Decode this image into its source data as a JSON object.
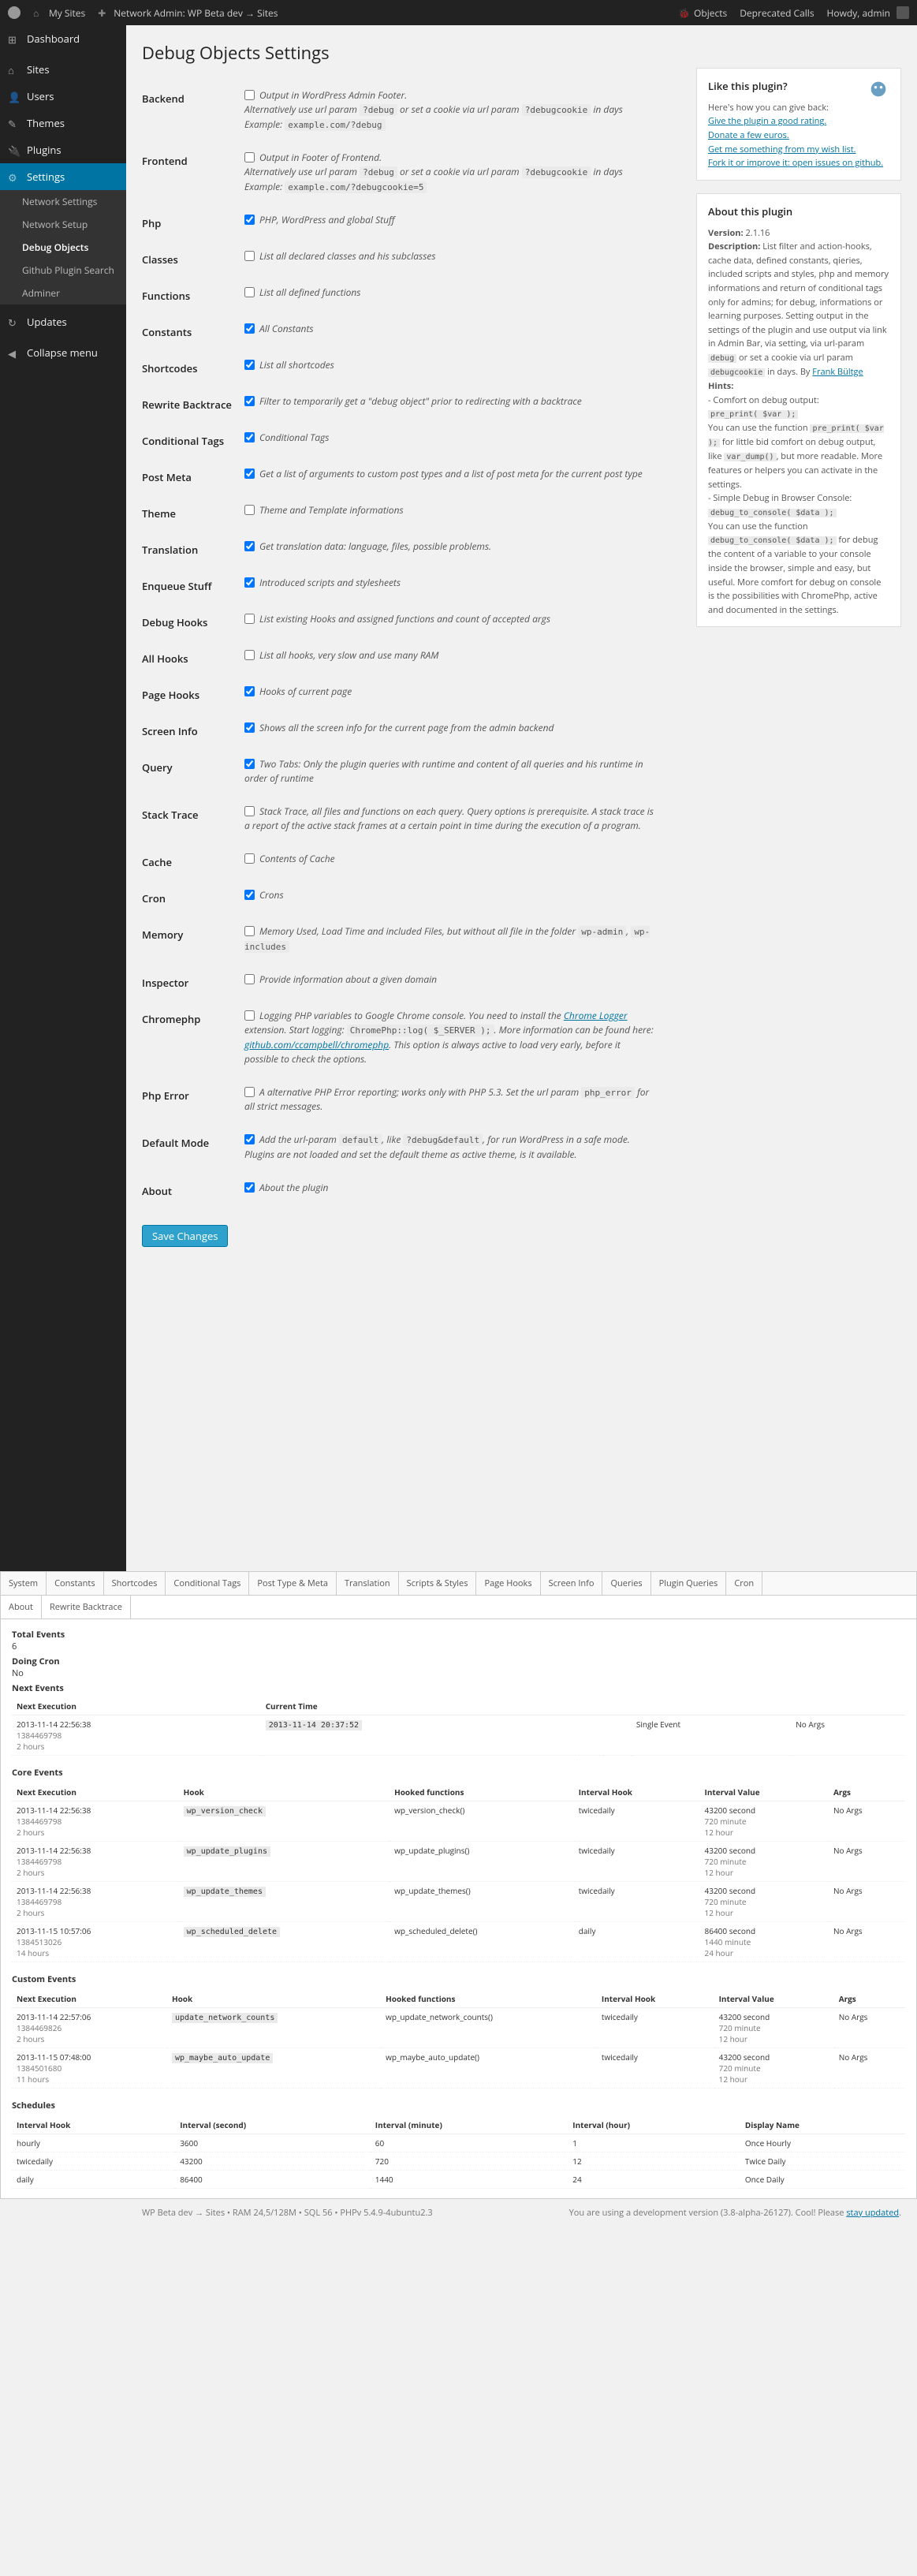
{
  "adminbar": {
    "mysites": "My Sites",
    "network": "Network Admin: WP Beta dev → Sites",
    "objects": "Objects",
    "deprecated": "Deprecated Calls",
    "howdy": "Howdy, admin"
  },
  "menu": {
    "dashboard": "Dashboard",
    "sites": "Sites",
    "users": "Users",
    "themes": "Themes",
    "plugins": "Plugins",
    "settings": "Settings",
    "sub_network_settings": "Network Settings",
    "sub_network_setup": "Network Setup",
    "sub_debug_objects": "Debug Objects",
    "sub_github_plugin_search": "Github Plugin Search",
    "sub_adminer": "Adminer",
    "updates": "Updates",
    "collapse": "Collapse menu"
  },
  "page": {
    "title": "Debug Objects Settings"
  },
  "rows": {
    "backend": {
      "label": "Backend",
      "text1": "Output in WordPress Admin Footer.",
      "text2": "Alternatively use url param ",
      "code1": "?debug",
      "text3": " or set a cookie via url param ",
      "code2": "?debugcookie",
      "text4": " in days",
      "text5": "Example: ",
      "code3": "example.com/?debug"
    },
    "frontend": {
      "label": "Frontend",
      "text1": "Output in Footer of Frontend.",
      "text2": "Alternatively use url param ",
      "code1": "?debug",
      "text3": " or set a cookie via url param ",
      "code2": "?debugcookie",
      "text4": " in days",
      "text5": "Example: ",
      "code3": "example.com/?debugcookie=5"
    },
    "php": {
      "label": "Php",
      "text": "PHP, WordPress and global Stuff"
    },
    "classes": {
      "label": "Classes",
      "text": "List all declared classes and his subclasses"
    },
    "functions": {
      "label": "Functions",
      "text": "List all defined functions"
    },
    "constants": {
      "label": "Constants",
      "text": "All Constants"
    },
    "shortcodes": {
      "label": "Shortcodes",
      "text": "List all shortcodes"
    },
    "rewrite": {
      "label": "Rewrite Backtrace",
      "text": "Filter to temporarily get a \"debug object\" prior to redirecting with a backtrace"
    },
    "condtags": {
      "label": "Conditional Tags",
      "text": "Conditional Tags"
    },
    "postmeta": {
      "label": "Post Meta",
      "text": "Get a list of arguments to custom post types and a list of post meta for the current post type"
    },
    "theme": {
      "label": "Theme",
      "text": "Theme and Template informations"
    },
    "translation": {
      "label": "Translation",
      "text": "Get translation data: language, files, possible problems."
    },
    "enqueue": {
      "label": "Enqueue Stuff",
      "text": "Introduced scripts and stylesheets"
    },
    "debughooks": {
      "label": "Debug Hooks",
      "text": "List existing Hooks and assigned functions and count of accepted args"
    },
    "allhooks": {
      "label": "All Hooks",
      "text": "List all hooks, very slow and use many RAM"
    },
    "pagehooks": {
      "label": "Page Hooks",
      "text": "Hooks of current page"
    },
    "screeninfo": {
      "label": "Screen Info",
      "text": "Shows all the screen info for the current page from the admin backend"
    },
    "query": {
      "label": "Query",
      "text": "Two Tabs: Only the plugin queries with runtime and content of all queries and his runtime in order of runtime"
    },
    "stacktrace": {
      "label": "Stack Trace",
      "text": "Stack Trace, all files and functions on each query. Query options is prerequisite. A stack trace is a report of the active stack frames at a certain point in time during the execution of a program."
    },
    "cache": {
      "label": "Cache",
      "text": "Contents of Cache"
    },
    "cron": {
      "label": "Cron",
      "text": "Crons"
    },
    "memory": {
      "label": "Memory",
      "text1": "Memory Used, Load Time and included Files, but without all file in the folder ",
      "code1": "wp-admin",
      "text2": ", ",
      "code2": "wp-includes"
    },
    "inspector": {
      "label": "Inspector",
      "text": "Provide information about a given domain"
    },
    "chromephp": {
      "label": "Chromephp",
      "text1": "Logging PHP variables to Google Chrome console. You need to install the ",
      "link1": "Chrome Logger",
      "text2": " extension. Start logging: ",
      "code1": "ChromePhp::log( $_SERVER );",
      "text3": ". More information can be found here: ",
      "link2": "github.com/ccampbell/chromephp",
      "text4": ". This option is always active to load very early, before it possible to check the options."
    },
    "phperror": {
      "label": "Php Error",
      "text1": "A alternative PHP Error reporting; works only with PHP 5.3. Set the url param ",
      "code1": "php_error",
      "text2": " for all strict messages."
    },
    "defaultmode": {
      "label": "Default Mode",
      "text1": "Add the url-param ",
      "code1": "default",
      "text2": ", like ",
      "code2": "?debug&default",
      "text3": ", for run WordPress in a safe mode. Plugins are not loaded and set the default theme as active theme, is it available."
    },
    "about": {
      "label": "About",
      "text": "About the plugin"
    }
  },
  "checked": {
    "backend": false,
    "frontend": false,
    "php": true,
    "classes": false,
    "functions": false,
    "constants": true,
    "shortcodes": true,
    "rewrite": true,
    "condtags": true,
    "postmeta": true,
    "theme": false,
    "translation": true,
    "enqueue": true,
    "debughooks": false,
    "allhooks": false,
    "pagehooks": true,
    "screeninfo": true,
    "query": true,
    "stacktrace": false,
    "cache": false,
    "cron": true,
    "memory": false,
    "inspector": false,
    "chromephp": false,
    "phperror": false,
    "defaultmode": true,
    "about": true
  },
  "save_button": "Save Changes",
  "box_like": {
    "title": "Like this plugin?",
    "intro": "Here's how you can give back:",
    "l1": "Give the plugin a good rating.",
    "l2": "Donate a few euros.",
    "l3": "Get me something from my wish list.",
    "l4": "Fork it or improve it: open issues on github."
  },
  "box_about": {
    "title": "About this plugin",
    "version_label": "Version:",
    "version": "2.1.16",
    "desc_label": "Description:",
    "desc1": "List filter and action-hooks, cache data, defined constants, qieries, included scripts and styles, php and memory informations and return of conditional tags only for admins; for debug, informations or learning purposes. Setting output in the settings of the plugin and use output via link in Admin Bar, via setting, via url-param ",
    "code1": "debug",
    "desc2": " or set a cookie via url param ",
    "code2": "debugcookie",
    "desc3": " in days. By ",
    "author": "Frank Bültge",
    "hints_label": "Hints:",
    "h1": "- Comfort on debug output:",
    "hc1": "pre_print( $var );",
    "h2": "You can use the function ",
    "hc2": "pre_print( $var );",
    "h3": " for little bid comfort on debug output, like ",
    "hc3": "var_dump()",
    "h4": ", but more readable. More features or helpers you can activate in the settings.",
    "h5": "- Simple Debug in Browser Console:",
    "hc4": "debug_to_console( $data );",
    "h6": "You can use the function ",
    "hc5": "debug_to_console( $data );",
    "h7": " for debug the content of a variable to your console inside the browser, simple and easy, but useful. More comfort for debug on console is the possibilities with ChromePhp, active and documented in the settings."
  },
  "tabs": {
    "main": [
      "System",
      "Constants",
      "Shortcodes",
      "Conditional Tags",
      "Post Type & Meta",
      "Translation",
      "Scripts & Styles",
      "Page Hooks",
      "Screen Info",
      "Queries",
      "Plugin Queries",
      "Cron"
    ],
    "sub": [
      "About",
      "Rewrite Backtrace"
    ]
  },
  "cron_info": {
    "total_events_label": "Total Events",
    "total_events": "6",
    "doing_cron_label": "Doing Cron",
    "doing_cron": "No",
    "next_events_label": "Next Events",
    "next_exec_label": "Next Execution",
    "current_time_label": "Current Time",
    "row1_time": "2013-11-14 22:56:38",
    "row1_ts": "1384469798",
    "row1_rel": "2 hours",
    "current_time": "2013-11-14 20:37:52",
    "single_event": "Single Event",
    "no_args": "No Args"
  },
  "core_events": {
    "title": "Core Events",
    "headers": [
      "Next Execution",
      "Hook",
      "Hooked functions",
      "Interval Hook",
      "Interval Value",
      "Args"
    ],
    "rows": [
      {
        "t": "2013-11-14 22:56:38",
        "ts": "1384469798",
        "rel": "2 hours",
        "hook": "wp_version_check",
        "fn": "wp_version_check()",
        "ih": "twicedaily",
        "iv1": "43200 second",
        "iv2": "720 minute",
        "iv3": "12 hour",
        "args": "No Args"
      },
      {
        "t": "2013-11-14 22:56:38",
        "ts": "1384469798",
        "rel": "2 hours",
        "hook": "wp_update_plugins",
        "fn": "wp_update_plugins()",
        "ih": "twicedaily",
        "iv1": "43200 second",
        "iv2": "720 minute",
        "iv3": "12 hour",
        "args": "No Args"
      },
      {
        "t": "2013-11-14 22:56:38",
        "ts": "1384469798",
        "rel": "2 hours",
        "hook": "wp_update_themes",
        "fn": "wp_update_themes()",
        "ih": "twicedaily",
        "iv1": "43200 second",
        "iv2": "720 minute",
        "iv3": "12 hour",
        "args": "No Args"
      },
      {
        "t": "2013-11-15 10:57:06",
        "ts": "1384513026",
        "rel": "14 hours",
        "hook": "wp_scheduled_delete",
        "fn": "wp_scheduled_delete()",
        "ih": "daily",
        "iv1": "86400 second",
        "iv2": "1440 minute",
        "iv3": "24 hour",
        "args": "No Args"
      }
    ]
  },
  "custom_events": {
    "title": "Custom Events",
    "headers": [
      "Next Execution",
      "Hook",
      "Hooked functions",
      "Interval Hook",
      "Interval Value",
      "Args"
    ],
    "rows": [
      {
        "t": "2013-11-14 22:57:06",
        "ts": "1384469826",
        "rel": "2 hours",
        "hook": "update_network_counts",
        "fn": "wp_update_network_counts()",
        "ih": "twicedaily",
        "iv1": "43200 second",
        "iv2": "720 minute",
        "iv3": "12 hour",
        "args": "No Args"
      },
      {
        "t": "2013-11-15 07:48:00",
        "ts": "1384501680",
        "rel": "11 hours",
        "hook": "wp_maybe_auto_update",
        "fn": "wp_maybe_auto_update()",
        "ih": "twicedaily",
        "iv1": "43200 second",
        "iv2": "720 minute",
        "iv3": "12 hour",
        "args": "No Args"
      }
    ]
  },
  "schedules": {
    "title": "Schedules",
    "headers": [
      "Interval Hook",
      "Interval (second)",
      "Interval (minute)",
      "Interval (hour)",
      "Display Name"
    ],
    "rows": [
      {
        "h": "hourly",
        "s": "3600",
        "m": "60",
        "hr": "1",
        "d": "Once Hourly"
      },
      {
        "h": "twicedaily",
        "s": "43200",
        "m": "720",
        "hr": "12",
        "d": "Twice Daily"
      },
      {
        "h": "daily",
        "s": "86400",
        "m": "1440",
        "hr": "24",
        "d": "Once Daily"
      }
    ]
  },
  "footer": {
    "left": "WP Beta dev → Sites • RAM 24,5/128M • SQL 56 • PHPv 5.4.9-4ubuntu2.3",
    "right1": "You are using a development version (3.8-alpha-26127). Cool! Please ",
    "right_link": "stay updated",
    "right2": "."
  }
}
